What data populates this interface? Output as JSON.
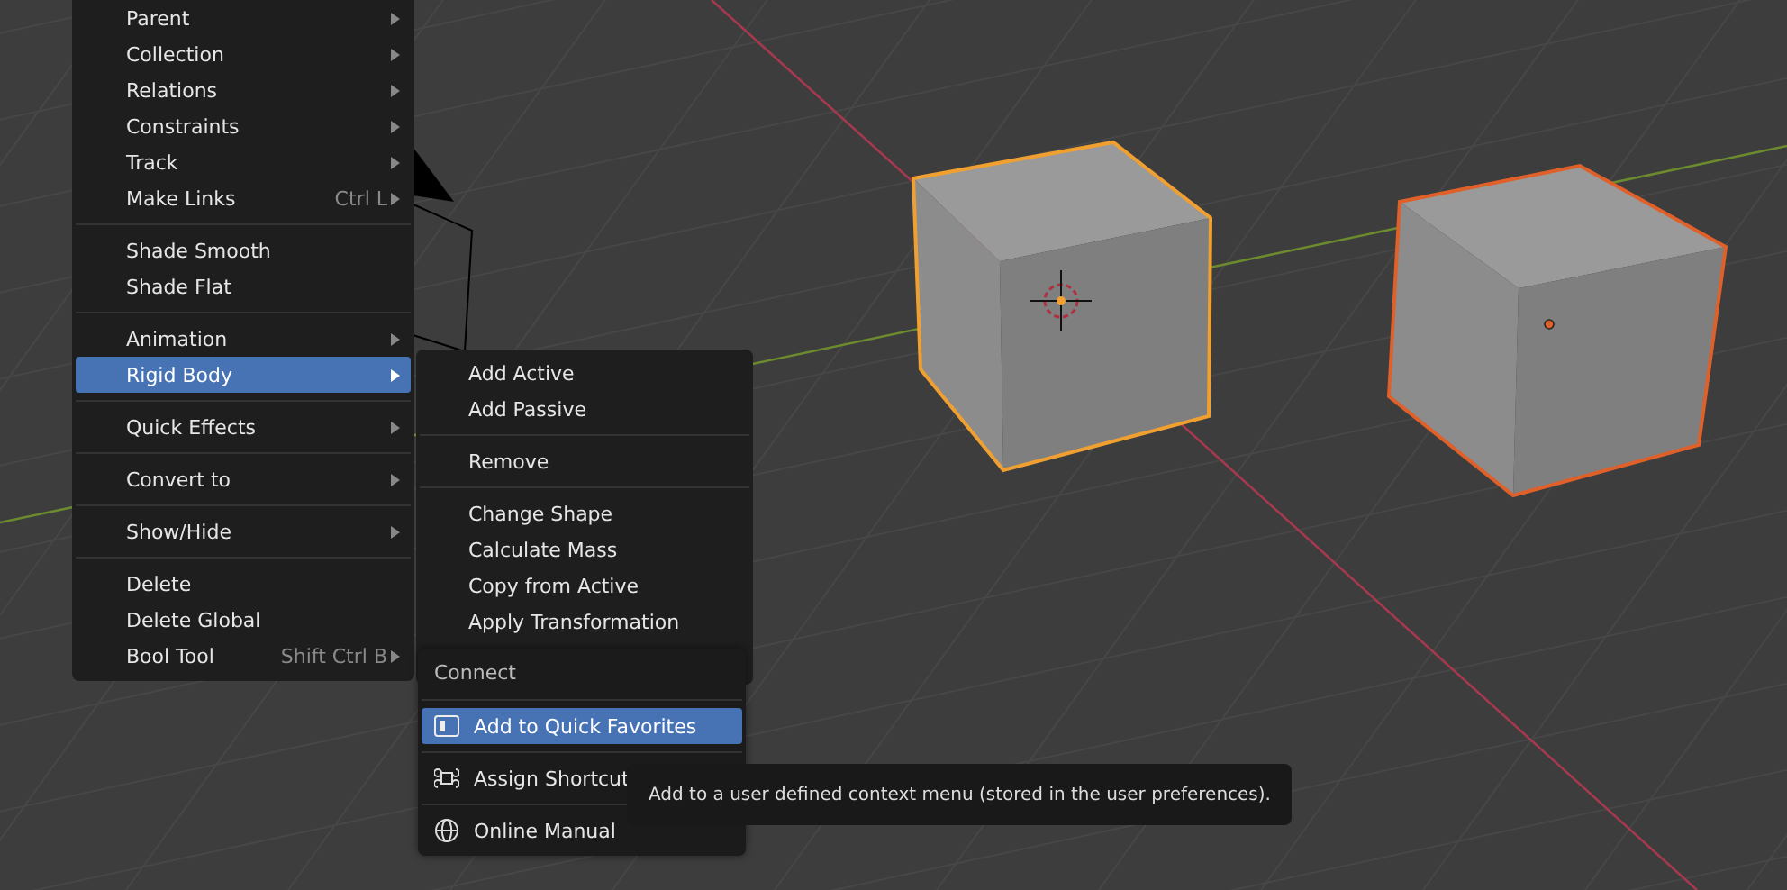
{
  "object_menu": {
    "items": [
      {
        "kind": "item",
        "label": "Parent",
        "submenu": true,
        "selected": false
      },
      {
        "kind": "item",
        "label": "Collection",
        "submenu": true,
        "selected": false
      },
      {
        "kind": "item",
        "label": "Relations",
        "submenu": true,
        "selected": false
      },
      {
        "kind": "item",
        "label": "Constraints",
        "submenu": true,
        "selected": false
      },
      {
        "kind": "item",
        "label": "Track",
        "submenu": true,
        "selected": false
      },
      {
        "kind": "item",
        "label": "Make Links",
        "shortcut": "Ctrl L",
        "submenu": true,
        "selected": false
      },
      {
        "kind": "separator"
      },
      {
        "kind": "item",
        "label": "Shade Smooth",
        "submenu": false,
        "selected": false
      },
      {
        "kind": "item",
        "label": "Shade Flat",
        "submenu": false,
        "selected": false
      },
      {
        "kind": "separator"
      },
      {
        "kind": "item",
        "label": "Animation",
        "submenu": true,
        "selected": false
      },
      {
        "kind": "item",
        "label": "Rigid Body",
        "submenu": true,
        "selected": true
      },
      {
        "kind": "separator"
      },
      {
        "kind": "item",
        "label": "Quick Effects",
        "submenu": true,
        "selected": false
      },
      {
        "kind": "separator"
      },
      {
        "kind": "item",
        "label": "Convert to",
        "submenu": true,
        "selected": false
      },
      {
        "kind": "separator"
      },
      {
        "kind": "item",
        "label": "Show/Hide",
        "submenu": true,
        "selected": false
      },
      {
        "kind": "separator"
      },
      {
        "kind": "item",
        "label": "Delete",
        "submenu": false,
        "selected": false
      },
      {
        "kind": "item",
        "label": "Delete Global",
        "submenu": false,
        "selected": false
      },
      {
        "kind": "item",
        "label": "Bool Tool",
        "shortcut": "Shift Ctrl B",
        "submenu": true,
        "selected": false
      }
    ]
  },
  "rigid_body_menu": {
    "items": [
      {
        "kind": "item",
        "label": "Add Active"
      },
      {
        "kind": "item",
        "label": "Add Passive"
      },
      {
        "kind": "separator"
      },
      {
        "kind": "item",
        "label": "Remove"
      },
      {
        "kind": "separator"
      },
      {
        "kind": "item",
        "label": "Change Shape"
      },
      {
        "kind": "item",
        "label": "Calculate Mass"
      },
      {
        "kind": "item",
        "label": "Copy from Active"
      },
      {
        "kind": "item",
        "label": "Apply Transformation"
      }
    ]
  },
  "context_menu": {
    "title": "Connect",
    "items": [
      {
        "label": "Add to Quick Favorites",
        "selected": true
      },
      {
        "label": "Assign Shortcut",
        "selected": false
      },
      {
        "label": "Online Manual",
        "selected": false
      }
    ]
  },
  "tooltip": {
    "text": "Add to a user defined context menu (stored in the user preferences)."
  }
}
